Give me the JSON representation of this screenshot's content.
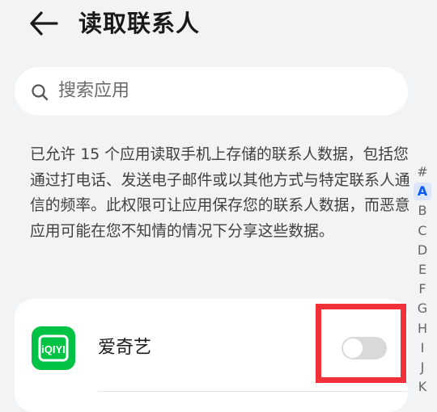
{
  "header": {
    "title": "读取联系人",
    "back_icon": "arrow-left-icon"
  },
  "search": {
    "placeholder": "搜索应用",
    "icon": "search-icon"
  },
  "description": "已允许 15 个应用读取手机上存储的联系人数据，包括您通过打电话、发送电子邮件或以其他方式与特定联系人通信的频率。此权限可让应用保存您的联系人数据，而恶意应用可能在您不知情的情况下分享这些数据。",
  "alpha_index": [
    "#",
    "A",
    "B",
    "C",
    "D",
    "E",
    "F",
    "G",
    "H",
    "I",
    "J",
    "K"
  ],
  "alpha_index_active": "A",
  "apps": [
    {
      "name": "爱奇艺",
      "icon": "iqiyi-icon",
      "icon_text": "iQIYI",
      "enabled": false
    }
  ],
  "colors": {
    "accent": "#0a59f7",
    "highlight_border": "#f2303a",
    "iqiyi_green": "#00c244",
    "toggle_off": "#d9d9d9"
  }
}
